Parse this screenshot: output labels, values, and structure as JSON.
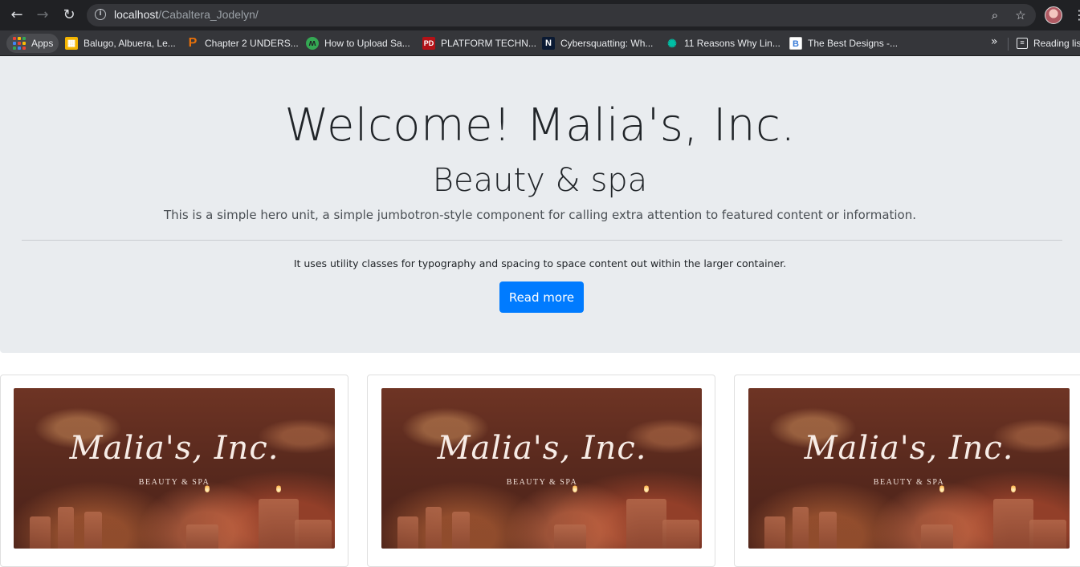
{
  "browser": {
    "url_host": "localhost",
    "url_path": "/Cabaltera_Jodelyn/",
    "bookmarks": [
      {
        "label": "Apps",
        "icon": "apps-grid-icon"
      },
      {
        "label": "Balugo, Albuera, Le...",
        "icon": "map-icon",
        "color": "#f4b400"
      },
      {
        "label": "Chapter 2 UNDERS...",
        "icon": "p-icon",
        "color": "#e8710a"
      },
      {
        "label": "How to Upload Sa...",
        "icon": "upload-icon",
        "color": "#34a853"
      },
      {
        "label": "PLATFORM TECHN...",
        "icon": "pd-icon",
        "color": "#b31217"
      },
      {
        "label": "Cybersquatting: Wh...",
        "icon": "n-icon",
        "color": "#0b3d91"
      },
      {
        "label": "11 Reasons Why Lin...",
        "icon": "gear-icon",
        "color": "#00bfa5"
      },
      {
        "label": "The Best Designs -...",
        "icon": "b-icon",
        "color": "#ffffff"
      }
    ],
    "more_bookmarks": "»",
    "reading_list": "Reading list"
  },
  "hero": {
    "title": "Welcome! Malia's, Inc.",
    "subtitle": "Beauty & spa",
    "lead": "This is a simple hero unit, a simple jumbotron-style component for calling extra attention to featured content or information.",
    "body": "It uses utility classes for typography and spacing to space content out within the larger container.",
    "button_label": "Read more",
    "button_color": "#007bff"
  },
  "cards": [
    {
      "logo_text": "Malia's, Inc.",
      "logo_subtext": "BEAUTY & SPA"
    },
    {
      "logo_text": "Malia's, Inc.",
      "logo_subtext": "BEAUTY & SPA"
    },
    {
      "logo_text": "Malia's, Inc.",
      "logo_subtext": "BEAUTY & SPA"
    }
  ]
}
